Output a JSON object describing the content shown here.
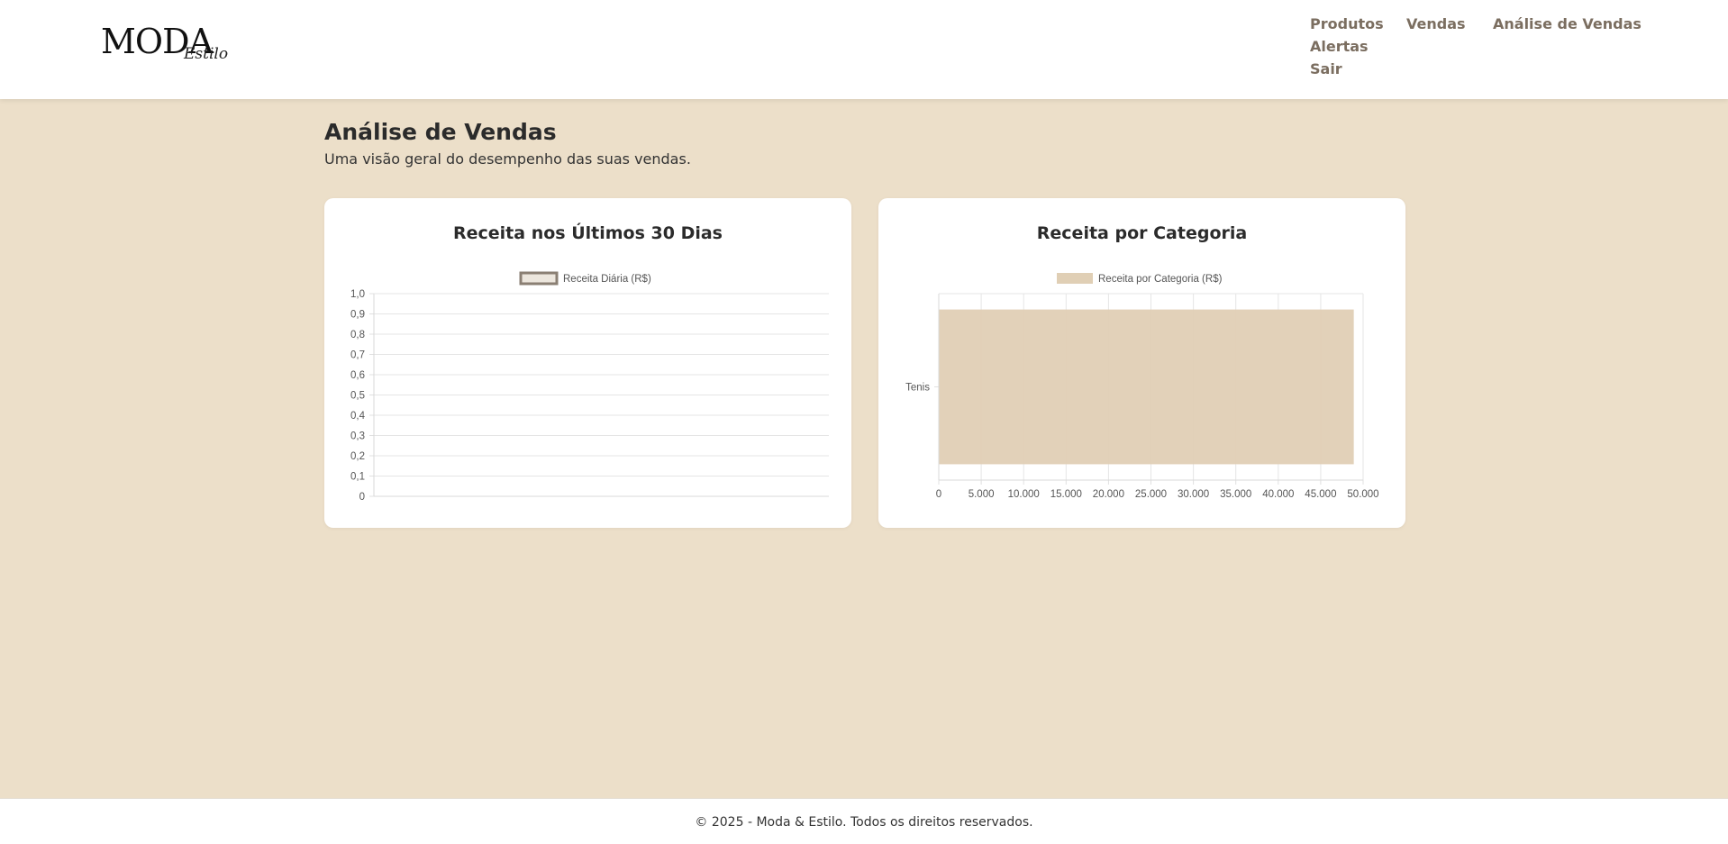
{
  "brand": {
    "logo_main": "MODA",
    "logo_script": "Estilo"
  },
  "nav": {
    "produtos": "Produtos",
    "vendas": "Vendas",
    "analise": "Análise de Vendas",
    "alertas": "Alertas",
    "sair": "Sair"
  },
  "page": {
    "title": "Análise de Vendas",
    "subtitle": "Uma visão geral do desempenho das suas vendas."
  },
  "cards": {
    "daily": {
      "title": "Receita nos Últimos 30 Dias"
    },
    "category": {
      "title": "Receita por Categoria"
    }
  },
  "colors": {
    "background": "#ecdfc9",
    "nav_link": "#7b6e60",
    "line_series_border": "#8a7f73",
    "line_series_fill": "#ece6dd",
    "bar_fill": "#e0cfb5"
  },
  "chart_data": [
    {
      "type": "line",
      "title": "Receita nos Últimos 30 Dias",
      "series": [
        {
          "name": "Receita Diária (R$)",
          "values": []
        }
      ],
      "legend_position": "top",
      "y_ticks": [
        "0",
        "0,1",
        "0,2",
        "0,3",
        "0,4",
        "0,5",
        "0,6",
        "0,7",
        "0,8",
        "0,9",
        "1,0"
      ],
      "ylim": [
        0,
        1
      ],
      "grid": true
    },
    {
      "type": "bar",
      "orientation": "horizontal",
      "title": "Receita por Categoria",
      "categories": [
        "Tenis"
      ],
      "series": [
        {
          "name": "Receita por Categoria (R$)",
          "values": [
            48900
          ]
        }
      ],
      "legend_position": "top",
      "x_ticks": [
        "0",
        "5.000",
        "10.000",
        "15.000",
        "20.000",
        "25.000",
        "30.000",
        "35.000",
        "40.000",
        "45.000",
        "50.000"
      ],
      "xlim": [
        0,
        50000
      ],
      "grid": true
    }
  ],
  "footer": {
    "text": "© 2025 - Moda & Estilo. Todos os direitos reservados."
  }
}
